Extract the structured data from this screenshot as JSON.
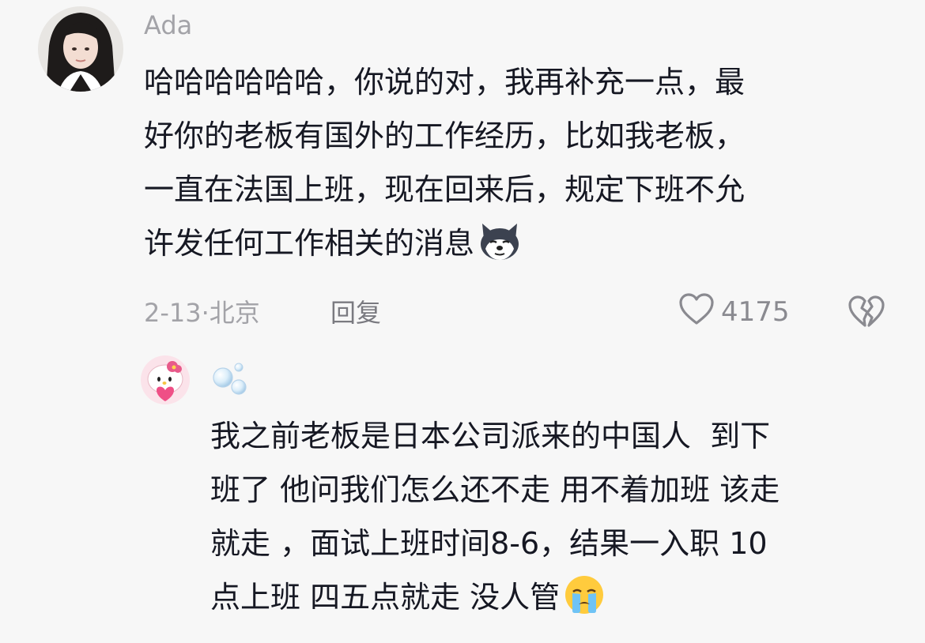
{
  "comment": {
    "username": "Ada",
    "text_lines": [
      "哈哈哈哈哈哈，你说的对，我再补充一点，最",
      "好你的老板有国外的工作经历，比如我老板，",
      "一直在法国上班，现在回来后，规定下班不允",
      "许发任何工作相关的消息"
    ],
    "emoji": "husky-dog-emoji",
    "date": "2-13",
    "separator": "·",
    "location": "北京",
    "reply_label": "回复",
    "like_count": "4175",
    "like_icon": "heart-outline-icon",
    "dislike_icon": "broken-heart-icon"
  },
  "reply": {
    "username_icon": "bubbles-icon",
    "text_lines": [
      "我之前老板是日本公司派来的中国人  到下",
      "班了 他问我们怎么还不走 用不着加班 该走",
      "就走 ，面试上班时间8-6，结果一入职 10",
      "点上班 四五点就走 没人管"
    ],
    "emoji": "crying-face-emoji"
  },
  "colors": {
    "background": "#f7f7f7",
    "text": "#161823",
    "muted": "#a3a3a8"
  }
}
